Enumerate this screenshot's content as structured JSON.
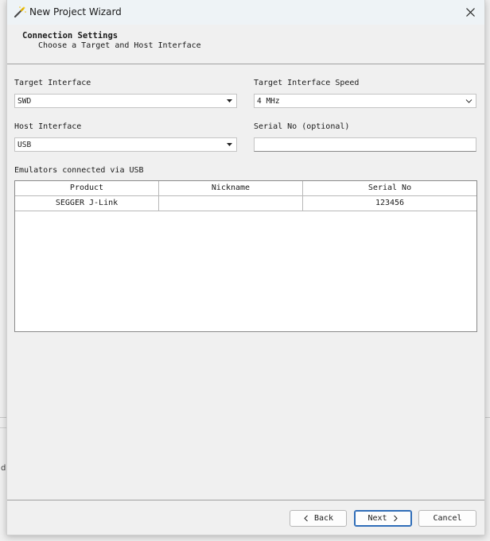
{
  "window": {
    "title": "New Project Wizard",
    "close_icon": "close-icon"
  },
  "header": {
    "heading": "Connection Settings",
    "subheading": "Choose a Target and Host Interface"
  },
  "form": {
    "target_interface": {
      "label": "Target Interface",
      "value": "SWD"
    },
    "target_interface_speed": {
      "label": "Target Interface Speed",
      "value": "4 MHz"
    },
    "host_interface": {
      "label": "Host Interface",
      "value": "USB"
    },
    "serial_no": {
      "label": "Serial No (optional)",
      "value": ""
    }
  },
  "emulators": {
    "label": "Emulators connected via USB",
    "columns": [
      "Product",
      "Nickname",
      "Serial No"
    ],
    "rows": [
      {
        "product": "SEGGER J-Link",
        "nickname": "",
        "serial": "123456"
      }
    ]
  },
  "buttons": {
    "back": "Back",
    "next": "Next",
    "cancel": "Cancel"
  },
  "background": {
    "fragment_char": "d"
  }
}
